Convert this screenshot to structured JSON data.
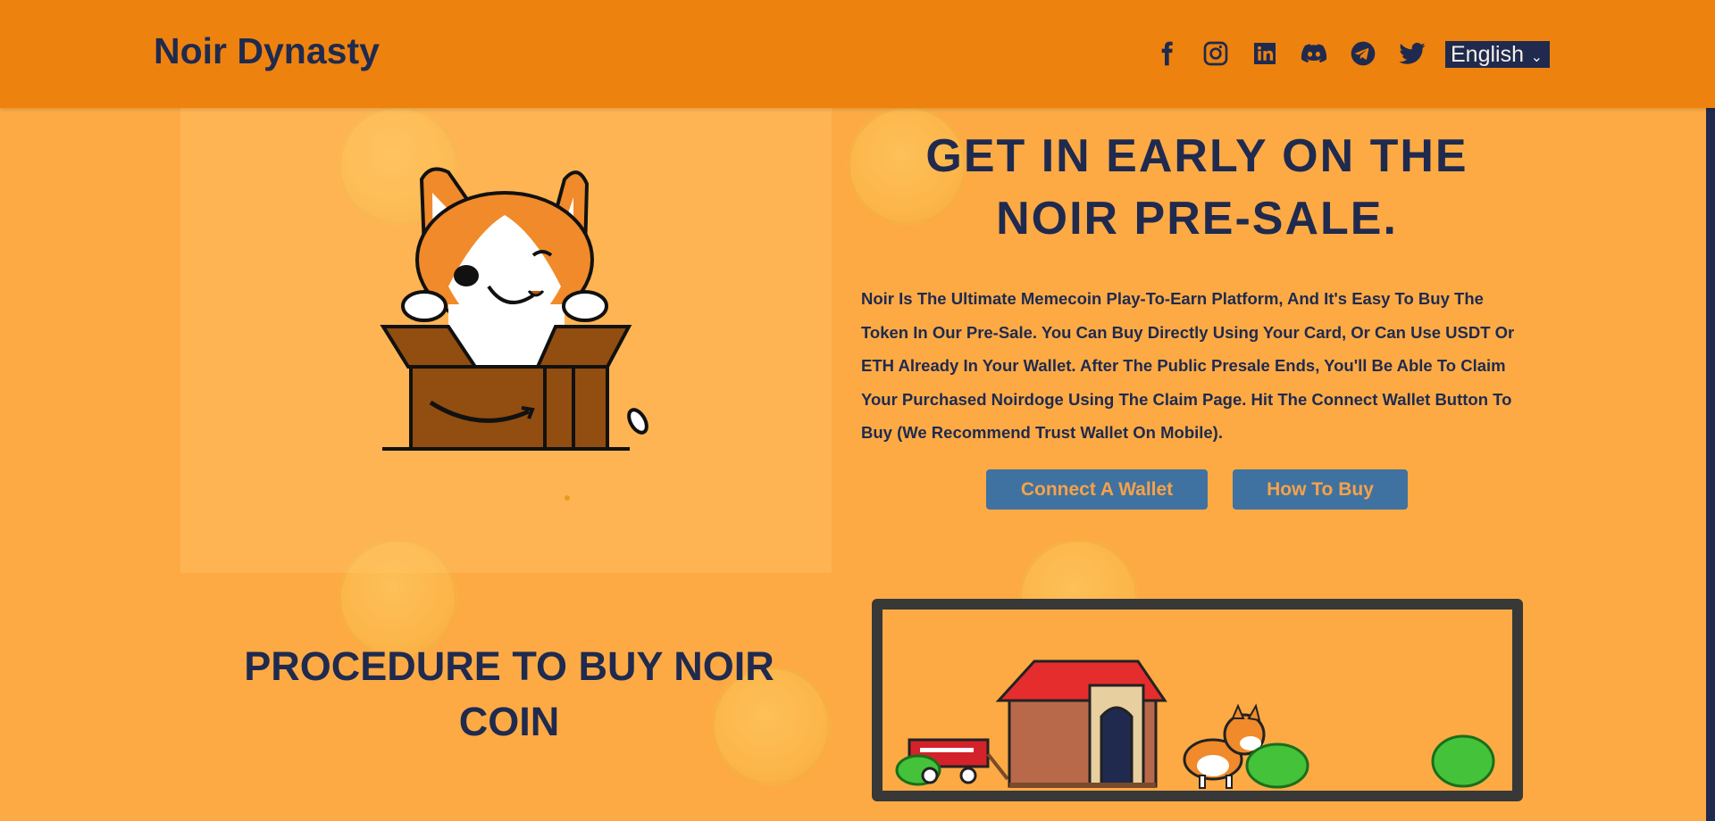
{
  "header": {
    "brand": "Noir Dynasty",
    "socials": [
      {
        "name": "facebook-icon"
      },
      {
        "name": "instagram-icon"
      },
      {
        "name": "linkedin-icon"
      },
      {
        "name": "discord-icon"
      },
      {
        "name": "telegram-icon"
      },
      {
        "name": "twitter-icon"
      }
    ],
    "language": {
      "selected": "English"
    }
  },
  "hero": {
    "title_line1": "GET IN EARLY ON THE",
    "title_line2": "NOIR PRE-SALE.",
    "description": "Noir Is The Ultimate Memecoin Play-To-Earn Platform, And It's Easy To Buy The Token In Our Pre-Sale. You Can Buy Directly Using Your Card, Or Can Use USDT Or ETH Already In Your Wallet. After The Public Presale Ends, You'll Be Able To Claim Your Purchased Noirdoge Using The Claim Page. Hit The Connect Wallet Button To Buy (We Recommend Trust Wallet On Mobile).",
    "connect_label": "Connect A Wallet",
    "howto_label": "How To Buy"
  },
  "procedure": {
    "title_line1": "PROCEDURE TO BUY NOIR",
    "title_line2": "COIN"
  },
  "colors": {
    "page_bg": "#fdaa45",
    "header_bg": "#ee820f",
    "navy": "#1f2a4e",
    "button_bg": "#3f72a0",
    "button_text": "#f6a24a"
  }
}
